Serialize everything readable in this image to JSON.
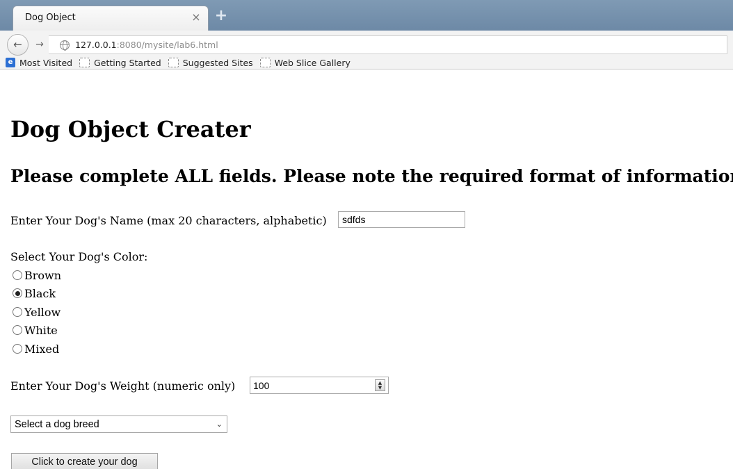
{
  "browser": {
    "tab_title": "Dog Object",
    "tab_close": "×",
    "new_tab": "+",
    "back": "←",
    "forward": "→",
    "url_host": "127.0.0.1",
    "url_rest": ":8080/mysite/lab6.html",
    "bookmarks": [
      "Most Visited",
      "Getting Started",
      "Suggested Sites",
      "Web Slice Gallery"
    ]
  },
  "page": {
    "heading": "Dog Object Creater",
    "subheading": "Please complete ALL fields. Please note the required format of information.",
    "name_label": "Enter Your Dog's Name (max 20 characters, alphabetic)",
    "name_value": "sdfds",
    "color_label": "Select Your Dog's Color:",
    "colors": [
      {
        "label": "Brown",
        "checked": false
      },
      {
        "label": "Black",
        "checked": true
      },
      {
        "label": "Yellow",
        "checked": false
      },
      {
        "label": "White",
        "checked": false
      },
      {
        "label": "Mixed",
        "checked": false
      }
    ],
    "weight_label": "Enter Your Dog's Weight (numeric only)",
    "weight_value": "100",
    "breed_selected": "Select a dog breed",
    "submit_label": "Click to create your dog"
  }
}
